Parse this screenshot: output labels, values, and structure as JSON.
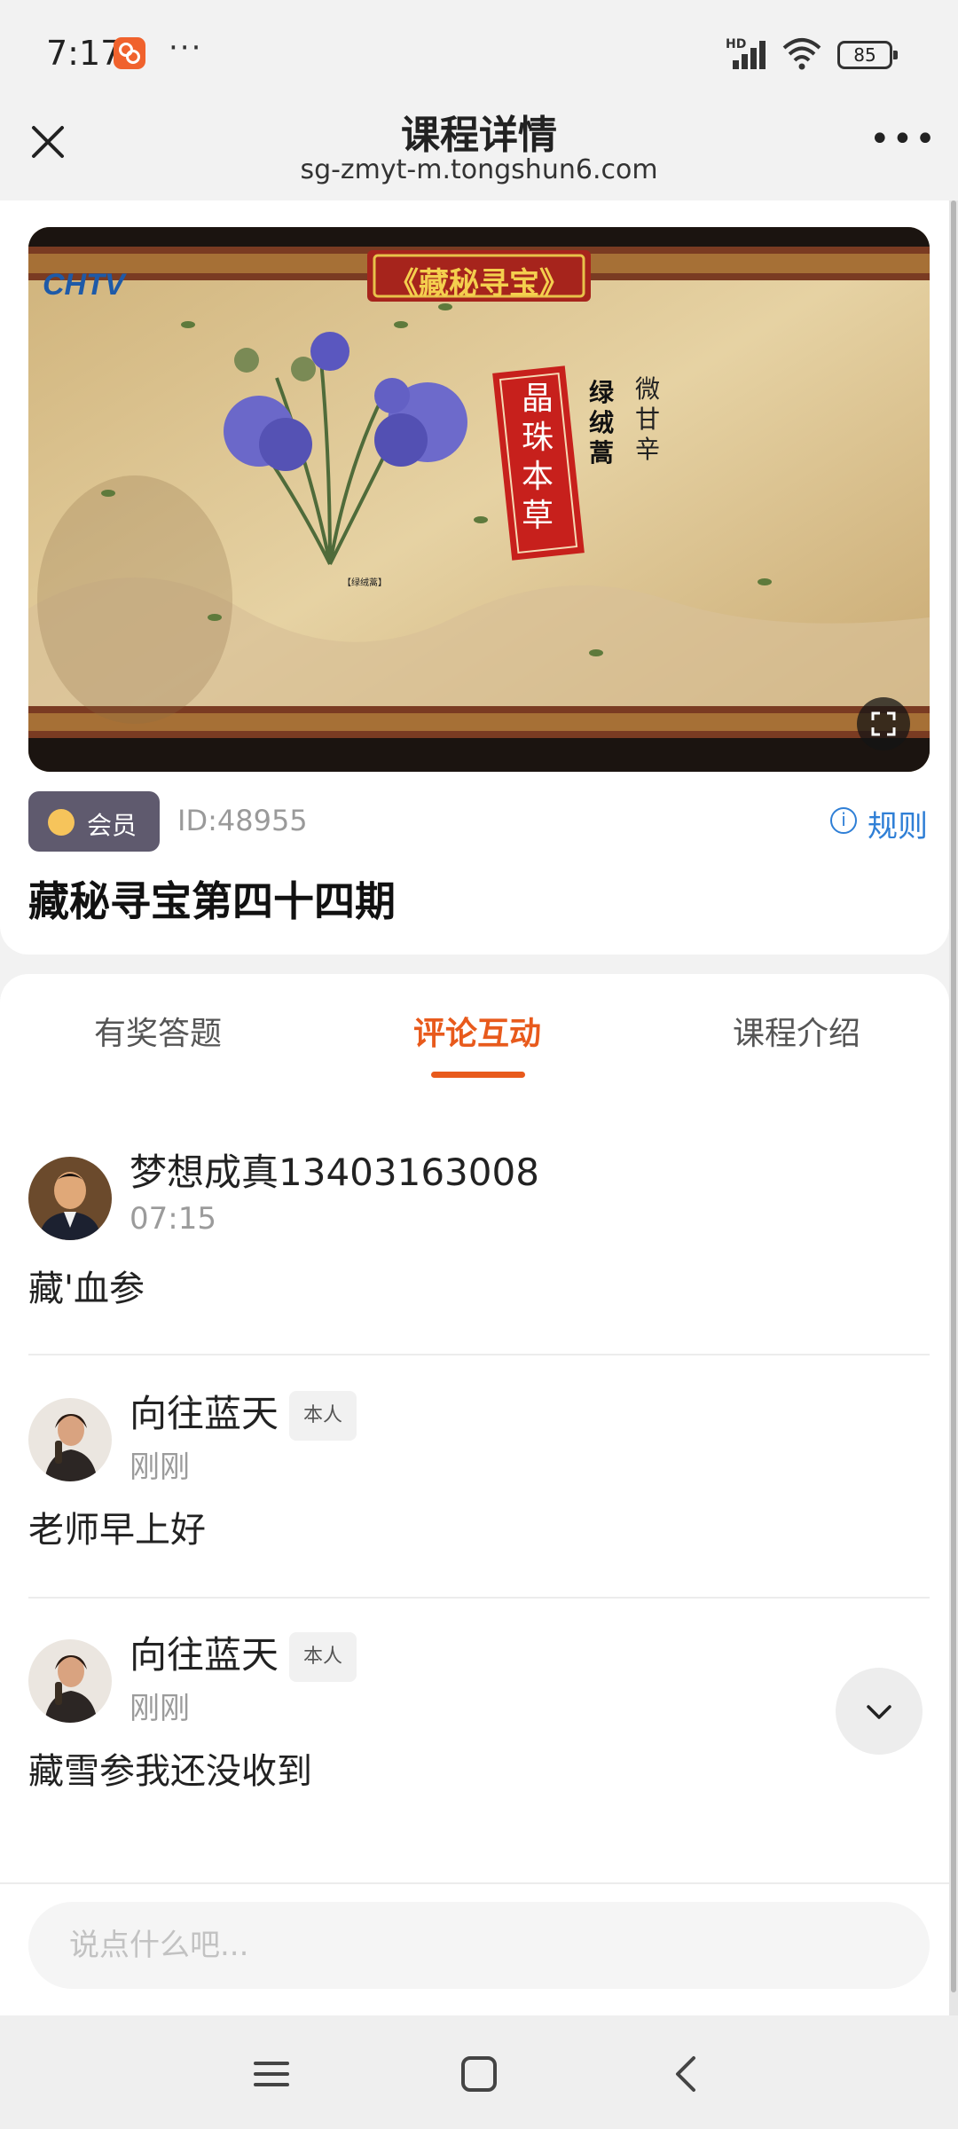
{
  "status_bar": {
    "time": "7:17",
    "app_icon": "taobao-style-app-icon",
    "dots": "···",
    "hd_label": "HD",
    "battery": "85"
  },
  "nav": {
    "title": "课程详情",
    "url": "sg-zmyt-m.tongshun6.com",
    "close_icon": "close-icon",
    "more": "•••"
  },
  "video": {
    "channel_logo": "CHTV",
    "show_banner": "《藏秘寻宝》",
    "herb_name": "晶珠本草",
    "herb_label": "绿绒蒿",
    "herb_taste": "微甘辛",
    "herb_caption": "【绿绒蒿】"
  },
  "course": {
    "member_label": "会员",
    "id_text": "ID:48955",
    "rules_label": "规则",
    "title": "藏秘寻宝第四十四期"
  },
  "tabs": [
    {
      "label": "有奖答题",
      "active": false
    },
    {
      "label": "评论互动",
      "active": true
    },
    {
      "label": "课程介绍",
      "active": false
    }
  ],
  "comments": [
    {
      "name": "梦想成真13403163008",
      "self_tag": "",
      "time": "07:15",
      "text": "藏'血参"
    },
    {
      "name": "向往蓝天",
      "self_tag": "本人",
      "time": "刚刚",
      "text": "老师早上好"
    },
    {
      "name": "向往蓝天",
      "self_tag": "本人",
      "time": "刚刚",
      "text": "藏雪参我还没收到"
    }
  ],
  "input": {
    "placeholder": "说点什么吧..."
  },
  "colors": {
    "accent": "#e85a1c",
    "link": "#2f7fd6",
    "member_badge": "#5f5a6e"
  }
}
